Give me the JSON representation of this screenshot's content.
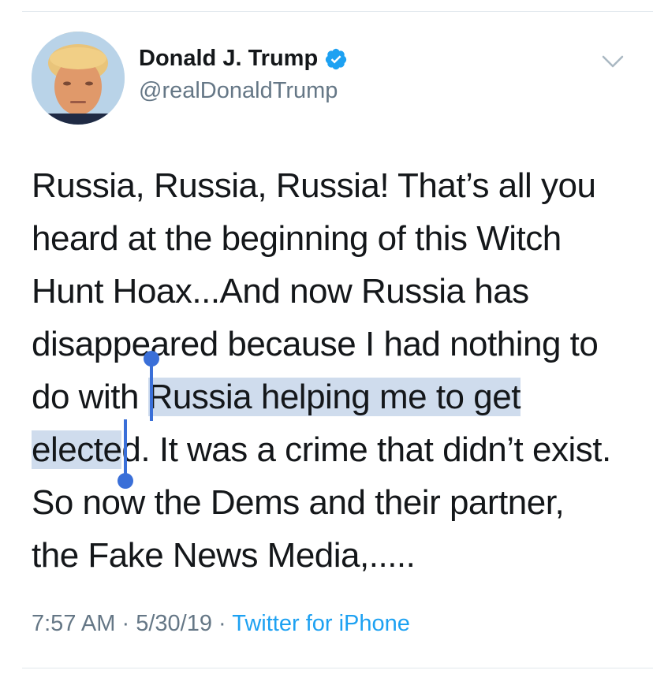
{
  "tweet": {
    "author": {
      "name": "Donald J. Trump",
      "handle": "@realDonaldTrump",
      "verified": true,
      "avatar_icon": "profile-photo"
    },
    "text_lines": [
      {
        "pre": "Russia, Russia, Russia! That’s all you",
        "sel": "",
        "post": ""
      },
      {
        "pre": "heard at the beginning of this Witch",
        "sel": "",
        "post": ""
      },
      {
        "pre": "Hunt Hoax...And now Russia has",
        "sel": "",
        "post": ""
      },
      {
        "pre": "disappeared because I had nothing to",
        "sel": "",
        "post": ""
      },
      {
        "pre": "do with ",
        "sel": "Russia helping me to get",
        "post": ""
      },
      {
        "pre": "",
        "sel": "electe",
        "post": "d. It was a crime that didn’t exist."
      },
      {
        "pre": "So now the Dems and their partner,",
        "sel": "",
        "post": ""
      },
      {
        "pre": "the Fake News Media,.....",
        "sel": "",
        "post": ""
      }
    ],
    "time": "7:57 AM",
    "separator": "·",
    "date": "5/30/19",
    "source": "Twitter for iPhone"
  },
  "colors": {
    "link": "#1da1f2",
    "secondary_text": "#657786",
    "selection": "#cfdced",
    "selection_handle": "#3a6fd8",
    "verified_badge": "#1da1f2"
  },
  "icons": {
    "verified": "verified-badge-icon",
    "more": "chevron-down-icon"
  }
}
